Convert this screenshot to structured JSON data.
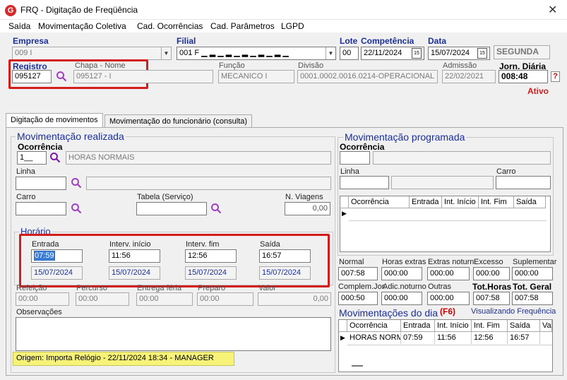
{
  "window": {
    "app_icon": "G",
    "title": "FRQ - Digitação de Freqüência",
    "close": "✕"
  },
  "menu": [
    "Saída",
    "Movimentação Coletiva",
    "Cad. Ocorrências",
    "Cad. Parâmetros",
    "LGPD"
  ],
  "header": {
    "empresa_label": "Empresa",
    "empresa_value": "009 I",
    "filial_label": "Filial",
    "filial_value": "001 F ▁ ▂ ▁ ▂ ▁ ▂ ▁ ▂ ▁ ▂ ▁",
    "lote_label": "Lote",
    "lote_value": "00",
    "competencia_label": "Competência",
    "competencia_value": "22/11/2024",
    "data_label": "Data",
    "data_value": "15/07/2024",
    "weekday": "SEGUNDA",
    "registro_label": "Registro",
    "registro_value": "095127",
    "chapa_nome_label": "Chapa  -  Nome",
    "chapa_nome_value": "095127 - I",
    "funcao_label": "Função",
    "funcao_value": "MECANICO I",
    "divisao_label": "Divisão",
    "divisao_value": "0001.0002.0016.0214-OPERACIONAL",
    "admissao_label": "Admissão",
    "admissao_value": "22/02/2021",
    "jorn_label": "Jorn. Diária",
    "jorn_value": "008:48",
    "help": "?",
    "status": "Ativo"
  },
  "tabs": [
    "Digitação de movimentos",
    "Movimentação do funcionário (consulta)"
  ],
  "realizada": {
    "title": "Movimentação realizada",
    "ocorrencia_label": "Ocorrência",
    "ocorrencia_code": "1__",
    "ocorrencia_desc": "HORAS NORMAIS",
    "linha_label": "Linha",
    "carro_label": "Carro",
    "tabela_label": "Tabela (Serviço)",
    "nviagens_label": "N. Viagens",
    "nviagens_value": "0,00"
  },
  "horario": {
    "title": "Horário",
    "entrada_label": "Entrada",
    "entrada_time": "07:59",
    "entrada_date": "15/07/2024",
    "interv_inicio_label": "Interv. início",
    "interv_inicio_time": "11:56",
    "interv_inicio_date": "15/07/2024",
    "interv_fim_label": "Interv. fim",
    "interv_fim_time": "12:56",
    "interv_fim_date": "15/07/2024",
    "saida_label": "Saída",
    "saida_time": "16:57",
    "saida_date": "15/07/2024"
  },
  "extras": {
    "refeicao_label": "Refeição",
    "refeicao_value": "00:00",
    "percurso_label": "Percurso",
    "percurso_value": "00:00",
    "entrega_label": "Entrega féria",
    "entrega_value": "00:00",
    "preparo_label": "Preparo",
    "preparo_value": "00:00",
    "valor_label": "Valor",
    "valor_value": "0,00"
  },
  "observacoes_label": "Observações",
  "origem": "Origem: Importa Relógio - 22/11/2024 18:34 - MANAGER",
  "programada": {
    "title": "Movimentação programada",
    "ocorrencia_label": "Ocorrência",
    "linha_label": "Linha",
    "carro_label": "Carro",
    "grid_headers": [
      "Ocorrência",
      "Entrada",
      "Int. Início",
      "Int. Fim",
      "Saída"
    ]
  },
  "totals": {
    "normal_label": "Normal",
    "normal_value": "007:58",
    "horas_extras_label": "Horas extras",
    "horas_extras_value": "000:00",
    "extras_noturn_label": "Extras noturn.",
    "extras_noturn_value": "000:00",
    "excesso_label": "Excesso",
    "excesso_value": "000:00",
    "suplementar_label": "Suplementar",
    "suplementar_value": "000:00",
    "complem_label": "Complem.Jor.",
    "complem_value": "000:50",
    "adic_noturno_label": "Adic.noturno",
    "adic_noturno_value": "000:00",
    "outras_label": "Outras",
    "outras_value": "000:00",
    "tot_horas_label": "Tot.Horas",
    "tot_horas_value": "007:58",
    "tot_geral_label": "Tot. Geral",
    "tot_geral_value": "007:58"
  },
  "mov_dia": {
    "title": "Movimentações do dia",
    "shortcut": "(F6)",
    "link": "Visualizando Frequência",
    "headers": [
      "Ocorrência",
      "Entrada",
      "Int. Início",
      "Int. Fim",
      "Saída",
      "Va"
    ],
    "row": [
      "HORAS NORM",
      "07:59",
      "11:56",
      "12:56",
      "16:57",
      ""
    ]
  },
  "colors": {
    "accent_blue": "#1a2f9a",
    "highlight_red": "#d41c1c",
    "status_yellow": "#f6f378"
  }
}
